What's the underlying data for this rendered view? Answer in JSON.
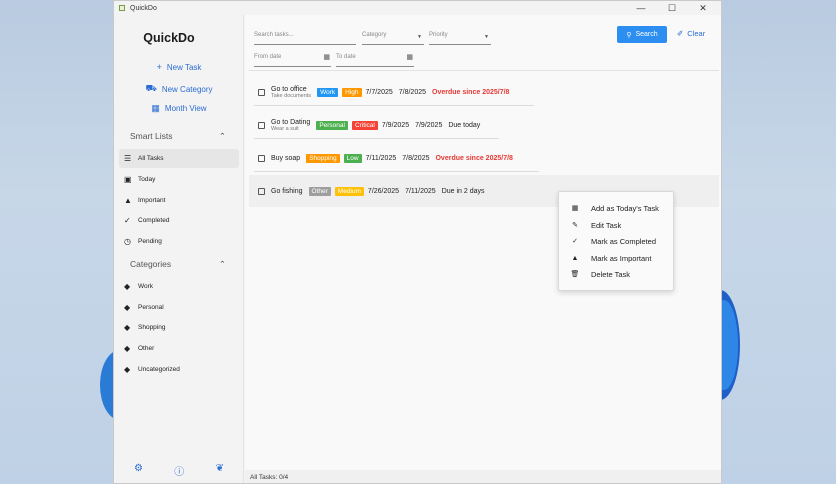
{
  "window": {
    "title": "QuickDo",
    "controls": [
      "—",
      "☐",
      "✕"
    ]
  },
  "sidebar": {
    "logo": "QuickDo",
    "actions": [
      {
        "label": "New Task",
        "icon": "plus-icon"
      },
      {
        "label": "New Category",
        "icon": "category-icon"
      },
      {
        "label": "Month View",
        "icon": "calendar-icon"
      }
    ],
    "smart_lists_title": "Smart Lists",
    "smart_lists": [
      {
        "label": "All Tasks",
        "icon": "list-icon",
        "active": true
      },
      {
        "label": "Today",
        "icon": "calendar-day-icon"
      },
      {
        "label": "Important",
        "icon": "warning-icon"
      },
      {
        "label": "Completed",
        "icon": "check-icon"
      },
      {
        "label": "Pending",
        "icon": "clock-icon"
      }
    ],
    "categories_title": "Categories",
    "categories": [
      {
        "label": "Work"
      },
      {
        "label": "Personal"
      },
      {
        "label": "Shopping"
      },
      {
        "label": "Other"
      },
      {
        "label": "Uncategorized"
      }
    ],
    "bottom_icons": [
      "gear-icon",
      "info-icon",
      "leaf-icon"
    ]
  },
  "filters": {
    "search_placeholder": "Search tasks...",
    "category_placeholder": "Category",
    "priority_placeholder": "Priority",
    "from_date_placeholder": "From date",
    "to_date_placeholder": "To date",
    "search_label": "Search",
    "clear_label": "Clear"
  },
  "tasks": [
    {
      "name": "Go to office",
      "note": "Take documents",
      "category": "Work",
      "category_color": "#2196f3",
      "priority": "High",
      "priority_color": "#ff9800",
      "date1": "7/7/2025",
      "date2": "7/8/2025",
      "status": "Overdue since 2025/7/8",
      "overdue": true
    },
    {
      "name": "Go to Dating",
      "note": "Wear a suit",
      "category": "Personal",
      "category_color": "#4caf50",
      "priority": "Critical",
      "priority_color": "#f44336",
      "date1": "7/9/2025",
      "date2": "7/9/2025",
      "status": "Due today",
      "overdue": false
    },
    {
      "name": "Buy soap",
      "note": "",
      "category": "Shopping",
      "category_color": "#ff9800",
      "priority": "Low",
      "priority_color": "#4caf50",
      "date1": "7/11/2025",
      "date2": "7/8/2025",
      "status": "Overdue since 2025/7/8",
      "overdue": true
    },
    {
      "name": "Go fishing",
      "note": "",
      "category": "Other",
      "category_color": "#9e9e9e",
      "priority": "Medium",
      "priority_color": "#ffc107",
      "date1": "7/26/2025",
      "date2": "7/11/2025",
      "status": "Due in 2 days",
      "overdue": false
    }
  ],
  "context_menu": [
    {
      "label": "Add as Today's Task",
      "icon": "calendar-add-icon"
    },
    {
      "label": "Edit Task",
      "icon": "pencil-icon"
    },
    {
      "label": "Mark as Completed",
      "icon": "check-icon"
    },
    {
      "label": "Mark as Important",
      "icon": "warning-icon"
    },
    {
      "label": "Delete Task",
      "icon": "trash-icon"
    }
  ],
  "statusbar": {
    "text": "All Tasks: 0/4"
  }
}
